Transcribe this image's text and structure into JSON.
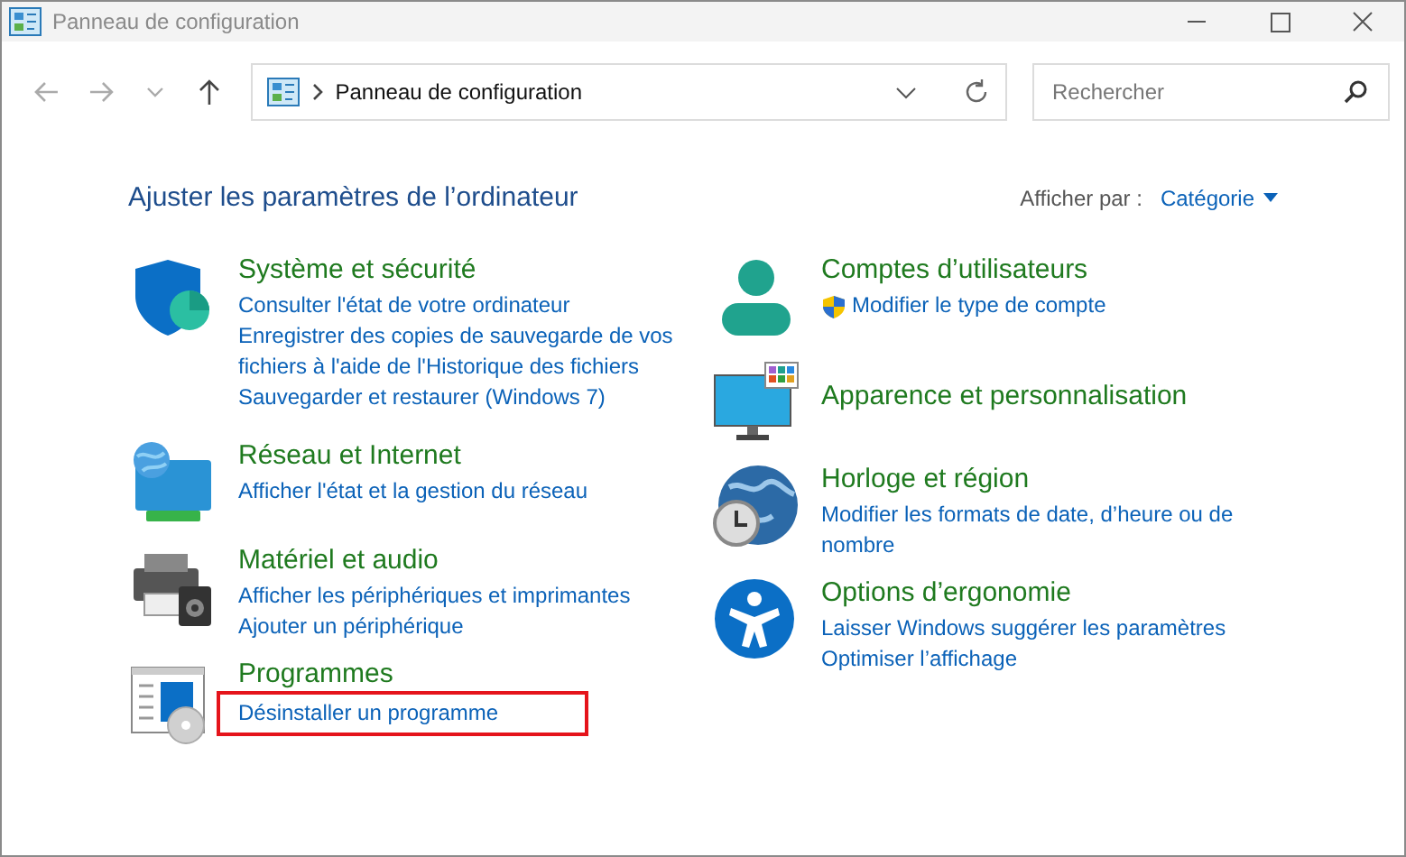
{
  "window": {
    "title": "Panneau de configuration"
  },
  "address_bar": {
    "path": "Panneau de configuration"
  },
  "search": {
    "placeholder": "Rechercher"
  },
  "heading": "Ajuster les paramètres de l’ordinateur",
  "view_by": {
    "label": "Afficher par :",
    "value": "Catégorie"
  },
  "columns": [
    {
      "categories": [
        {
          "kind": "security",
          "title": "Système et sécurité",
          "links": [
            {
              "text": "Consulter l'état de votre ordinateur",
              "shield": false,
              "highlighted": false
            },
            {
              "text": "Enregistrer des copies de sauvegarde de vos fichiers à l'aide de l'Historique des fichiers",
              "shield": false,
              "highlighted": false
            },
            {
              "text": "Sauvegarder et restaurer (Windows 7)",
              "shield": false,
              "highlighted": false
            }
          ]
        },
        {
          "kind": "network",
          "title": "Réseau et Internet",
          "links": [
            {
              "text": "Afficher l'état et la gestion du réseau",
              "shield": false,
              "highlighted": false
            }
          ]
        },
        {
          "kind": "hardware",
          "title": "Matériel et audio",
          "links": [
            {
              "text": "Afficher les périphériques et imprimantes",
              "shield": false,
              "highlighted": false
            },
            {
              "text": "Ajouter un périphérique",
              "shield": false,
              "highlighted": false
            }
          ]
        },
        {
          "kind": "programs",
          "title": "Programmes",
          "links": [
            {
              "text": "Désinstaller un programme",
              "shield": false,
              "highlighted": true
            }
          ]
        }
      ]
    },
    {
      "categories": [
        {
          "kind": "user",
          "title": "Comptes d’utilisateurs",
          "links": [
            {
              "text": "Modifier le type de compte",
              "shield": true,
              "highlighted": false
            }
          ]
        },
        {
          "kind": "appearance",
          "title": "Apparence et personnalisation"
        },
        {
          "kind": "clock",
          "title": "Horloge et région",
          "links": [
            {
              "text": "Modifier les formats de date, d’heure ou de nombre",
              "shield": false,
              "highlighted": false
            }
          ]
        },
        {
          "kind": "accessibility",
          "title": "Options d’ergonomie",
          "links": [
            {
              "text": "Laisser Windows suggérer les paramètres",
              "shield": false,
              "highlighted": false
            },
            {
              "text": "Optimiser l’affichage",
              "shield": false,
              "highlighted": false
            }
          ]
        }
      ]
    }
  ]
}
